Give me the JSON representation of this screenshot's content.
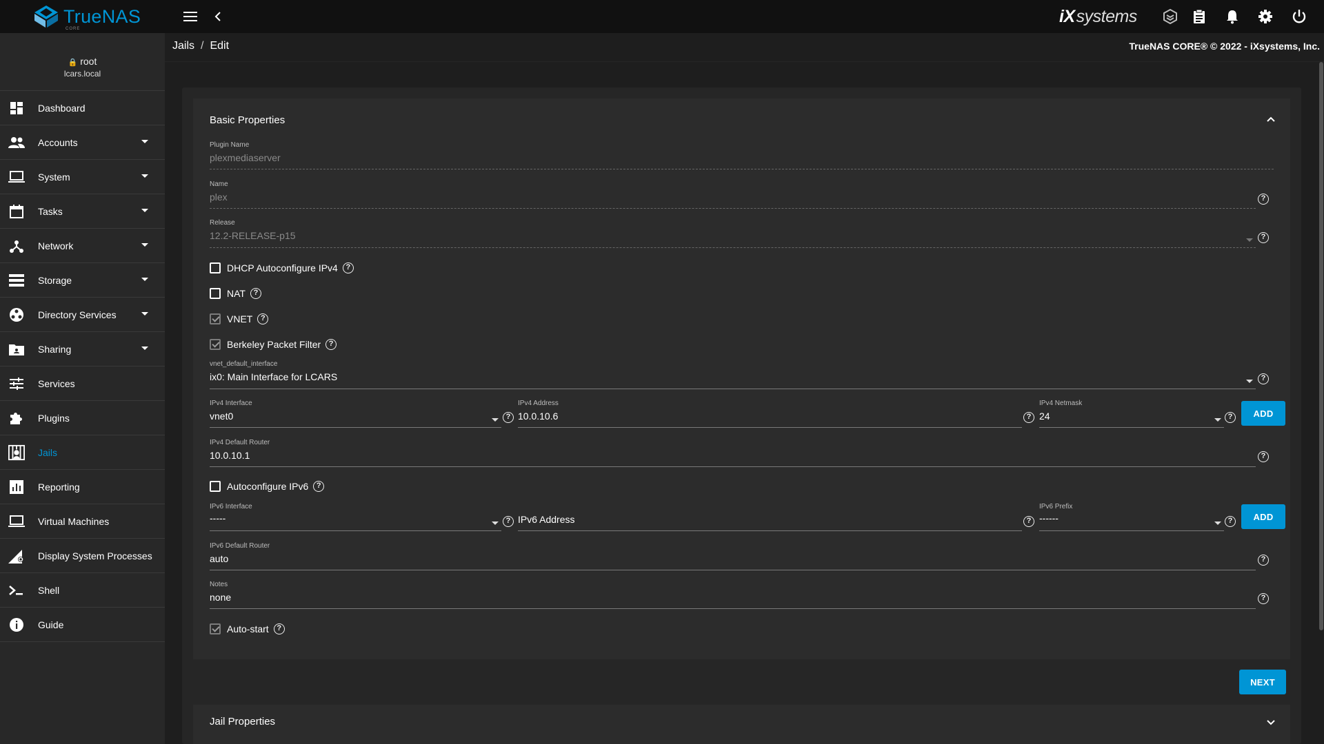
{
  "topbar": {
    "brand": "TrueNAS",
    "brand_sub": "CORE",
    "vendor_prefix": "iX",
    "vendor_suffix": "systems",
    "icons": [
      "menu-icon",
      "back-icon",
      "truecommand-icon",
      "tasks-icon",
      "bell-icon",
      "gear-icon",
      "power-icon"
    ]
  },
  "user": {
    "name": "root",
    "host": "lcars.local"
  },
  "sidebar": {
    "items": [
      {
        "label": "Dashboard",
        "icon": "dashboard-icon",
        "caret": false
      },
      {
        "label": "Accounts",
        "icon": "people-icon",
        "caret": true
      },
      {
        "label": "System",
        "icon": "laptop-icon",
        "caret": true
      },
      {
        "label": "Tasks",
        "icon": "calendar-icon",
        "caret": true
      },
      {
        "label": "Network",
        "icon": "network-icon",
        "caret": true
      },
      {
        "label": "Storage",
        "icon": "storage-icon",
        "caret": true
      },
      {
        "label": "Directory Services",
        "icon": "directory-icon",
        "caret": true
      },
      {
        "label": "Sharing",
        "icon": "folder-share-icon",
        "caret": true
      },
      {
        "label": "Services",
        "icon": "tune-icon",
        "caret": false
      },
      {
        "label": "Plugins",
        "icon": "puzzle-icon",
        "caret": false
      },
      {
        "label": "Jails",
        "icon": "jail-icon",
        "caret": false,
        "active": true
      },
      {
        "label": "Reporting",
        "icon": "chart-icon",
        "caret": false
      },
      {
        "label": "Virtual Machines",
        "icon": "computer-icon",
        "caret": false
      },
      {
        "label": "Display System Processes",
        "icon": "processes-icon",
        "caret": false
      },
      {
        "label": "Shell",
        "icon": "terminal-icon",
        "caret": false
      },
      {
        "label": "Guide",
        "icon": "info-icon",
        "caret": false
      }
    ]
  },
  "breadcrumb": {
    "root": "Jails",
    "sep": "/",
    "current": "Edit"
  },
  "copyright": "TrueNAS CORE® © 2022 - iXsystems, Inc.",
  "form": {
    "section_title": "Basic Properties",
    "plugin_name": {
      "label": "Plugin Name",
      "value": "plexmediaserver"
    },
    "name": {
      "label": "Name",
      "value": "plex"
    },
    "release": {
      "label": "Release",
      "value": "12.2-RELEASE-p15"
    },
    "dhcp": {
      "label": "DHCP Autoconfigure IPv4",
      "checked": false
    },
    "nat": {
      "label": "NAT",
      "checked": false
    },
    "vnet": {
      "label": "VNET",
      "checked": true
    },
    "bpf": {
      "label": "Berkeley Packet Filter",
      "checked": true
    },
    "vnet_default_interface": {
      "label": "vnet_default_interface",
      "value": "ix0: Main Interface for LCARS"
    },
    "ipv4_interface": {
      "label": "IPv4 Interface",
      "value": "vnet0"
    },
    "ipv4_address": {
      "label": "IPv4 Address",
      "value": "10.0.10.6"
    },
    "ipv4_netmask": {
      "label": "IPv4 Netmask",
      "value": "24"
    },
    "add_label": "ADD",
    "ipv4_default_router": {
      "label": "IPv4 Default Router",
      "value": "10.0.10.1"
    },
    "autoconf_ipv6": {
      "label": "Autoconfigure IPv6",
      "checked": false
    },
    "ipv6_interface": {
      "label": "IPv6 Interface",
      "value": "-----"
    },
    "ipv6_address": {
      "placeholder": "IPv6 Address"
    },
    "ipv6_prefix": {
      "label": "IPv6 Prefix",
      "value": "------"
    },
    "ipv6_default_router": {
      "label": "IPv6 Default Router",
      "value": "auto"
    },
    "notes": {
      "label": "Notes",
      "value": "none"
    },
    "autostart": {
      "label": "Auto-start",
      "checked": true
    },
    "next_label": "NEXT",
    "help_glyph": "?"
  },
  "section2_title": "Jail Properties",
  "colors": {
    "accent": "#0095d5",
    "topbar": "#111111",
    "sidebar": "#282828",
    "panel": "#2c2c2c"
  }
}
